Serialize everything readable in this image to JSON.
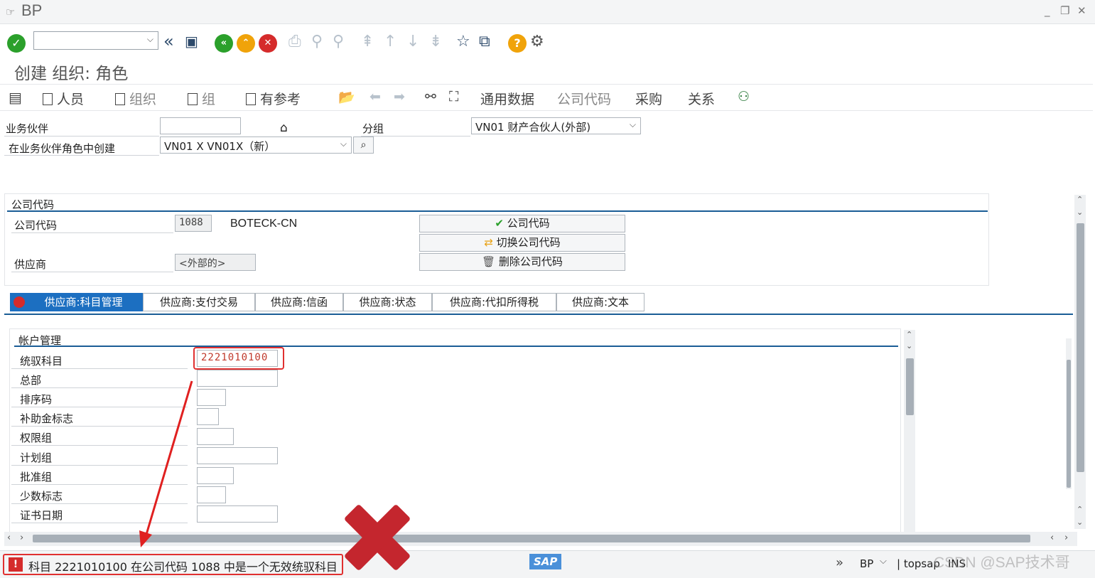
{
  "window": {
    "title": "BP"
  },
  "toolbar": {
    "command_value": ""
  },
  "page": {
    "title": "创建 组织: 角色"
  },
  "appbar": {
    "person": "人员",
    "organization": "组织",
    "group": "组",
    "with_reference": "有参考",
    "general_data": "通用数据",
    "company_code": "公司代码",
    "purchasing": "采购",
    "relationships": "关系"
  },
  "header": {
    "bp_label": "业务伙伴",
    "bp_value": "",
    "grouping_label": "分组",
    "grouping_value": "VN01 财产合伙人(外部)",
    "role_label": "在业务伙伴角色中创建",
    "role_value": "VN01  X VN01X（新）"
  },
  "company_section": {
    "title": "公司代码",
    "cc_label": "公司代码",
    "cc_value": "1088",
    "cc_name": "BOTECK-CN",
    "vendor_label": "供应商",
    "vendor_value": "<外部的>",
    "btn_company_code": "公司代码",
    "btn_switch": "切换公司代码",
    "btn_delete": "删除公司代码"
  },
  "tabs": [
    {
      "label": "供应商:科目管理"
    },
    {
      "label": "供应商:支付交易"
    },
    {
      "label": "供应商:信函"
    },
    {
      "label": "供应商:状态"
    },
    {
      "label": "供应商:代扣所得税"
    },
    {
      "label": "供应商:文本"
    }
  ],
  "account_section": {
    "title": "帐户管理",
    "fields": [
      {
        "label": "统驭科目",
        "value": "2221010100"
      },
      {
        "label": "总部",
        "value": ""
      },
      {
        "label": "排序码",
        "value": ""
      },
      {
        "label": "补助金标志",
        "value": ""
      },
      {
        "label": "权限组",
        "value": ""
      },
      {
        "label": "计划组",
        "value": ""
      },
      {
        "label": "批准组",
        "value": ""
      },
      {
        "label": "少数标志",
        "value": ""
      },
      {
        "label": "证书日期",
        "value": ""
      }
    ]
  },
  "status": {
    "message": "科目 2221010100 在公司代码 1088 中是一个无效统驭科目",
    "transaction": "BP",
    "system": "topsap",
    "mode": "INS",
    "sap_logo": "SAP",
    "watermark": "CSDN @SAP技术哥"
  },
  "colors": {
    "accent": "#1c6fc1",
    "error": "#e03030",
    "tab_bar": "#1a5d96"
  }
}
